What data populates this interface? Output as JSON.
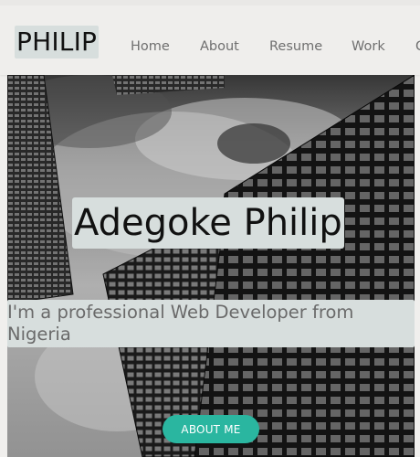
{
  "brand": {
    "logo_text": "PHILIP"
  },
  "nav": {
    "items": [
      {
        "label": "Home"
      },
      {
        "label": "About"
      },
      {
        "label": "Resume"
      },
      {
        "label": "Work"
      },
      {
        "label": "C"
      }
    ]
  },
  "hero": {
    "title": "Adegoke Philip",
    "subtitle": "I'm a professional Web Developer from Nigeria",
    "cta_label": "ABOUT ME"
  },
  "colors": {
    "accent": "#2ab6a0",
    "label_bg": "#d7dedd",
    "nav_text": "#6f6f6f"
  }
}
